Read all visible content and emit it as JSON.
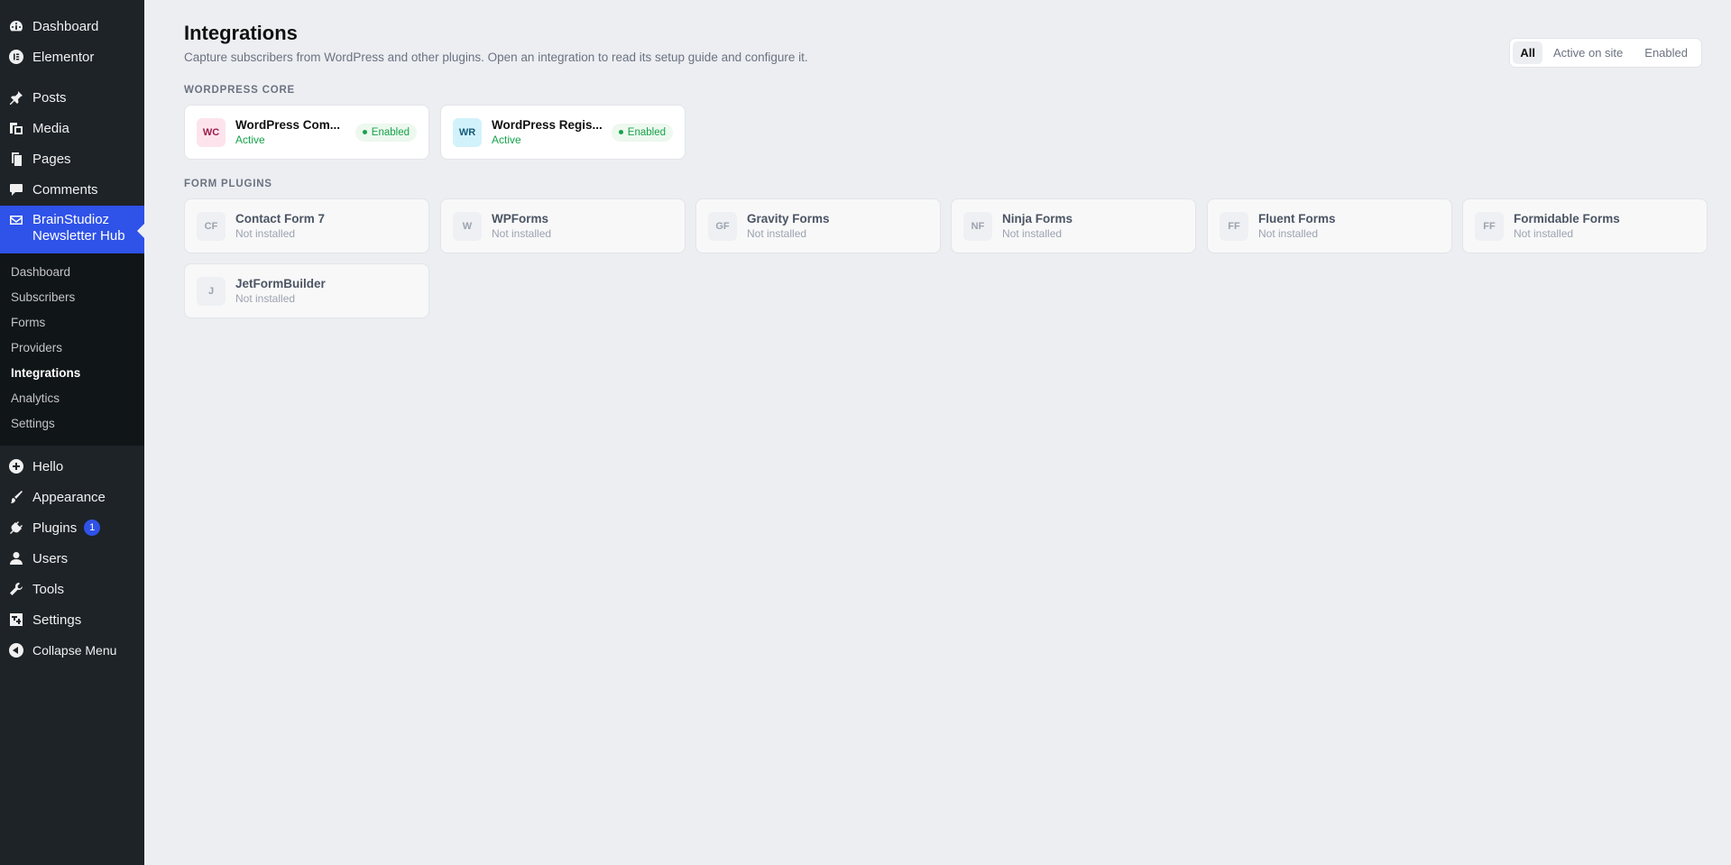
{
  "sidebar": {
    "top_items": [
      {
        "label": "Dashboard",
        "icon": "dashboard-icon"
      },
      {
        "label": "Elementor",
        "icon": "elementor-icon"
      }
    ],
    "content_items": [
      {
        "label": "Posts",
        "icon": "pin-icon"
      },
      {
        "label": "Media",
        "icon": "media-icon"
      },
      {
        "label": "Pages",
        "icon": "pages-icon"
      },
      {
        "label": "Comments",
        "icon": "comment-icon"
      }
    ],
    "current": {
      "label": "BrainStudioz Newsletter Hub",
      "icon": "mail-icon"
    },
    "submenu": [
      "Dashboard",
      "Subscribers",
      "Forms",
      "Providers",
      "Integrations",
      "Analytics",
      "Settings"
    ],
    "submenu_active": "Integrations",
    "bottom_items": [
      {
        "label": "Hello",
        "icon": "plus-circle-icon"
      },
      {
        "label": "Appearance",
        "icon": "brush-icon"
      },
      {
        "label": "Plugins",
        "icon": "plugin-icon",
        "badge": "1"
      },
      {
        "label": "Users",
        "icon": "user-icon"
      },
      {
        "label": "Tools",
        "icon": "wrench-icon"
      },
      {
        "label": "Settings",
        "icon": "settings-icon"
      },
      {
        "label": "Collapse Menu",
        "icon": "collapse-icon"
      }
    ]
  },
  "header": {
    "title": "Integrations",
    "description": "Capture subscribers from WordPress and other plugins. Open an integration to read its setup guide and configure it."
  },
  "filters": {
    "options": [
      "All",
      "Active on site",
      "Enabled"
    ],
    "selected": "All"
  },
  "sections": {
    "core": {
      "label": "WORDPRESS CORE",
      "cards": [
        {
          "initials": "WC",
          "title": "WordPress Com...",
          "status": "Active",
          "badge": "Enabled"
        },
        {
          "initials": "WR",
          "title": "WordPress Regis...",
          "status": "Active",
          "badge": "Enabled"
        }
      ]
    },
    "forms": {
      "label": "FORM PLUGINS",
      "cards": [
        {
          "initials": "CF",
          "title": "Contact Form 7",
          "status": "Not installed"
        },
        {
          "initials": "W",
          "title": "WPForms",
          "status": "Not installed"
        },
        {
          "initials": "GF",
          "title": "Gravity Forms",
          "status": "Not installed"
        },
        {
          "initials": "NF",
          "title": "Ninja Forms",
          "status": "Not installed"
        },
        {
          "initials": "FF",
          "title": "Fluent Forms",
          "status": "Not installed"
        },
        {
          "initials": "FF",
          "title": "Formidable Forms",
          "status": "Not installed"
        },
        {
          "initials": "J",
          "title": "JetFormBuilder",
          "status": "Not installed"
        }
      ]
    }
  },
  "colors": {
    "accent": "#2f52e8",
    "sidebar": "#1d2327",
    "success": "#16a34a"
  }
}
